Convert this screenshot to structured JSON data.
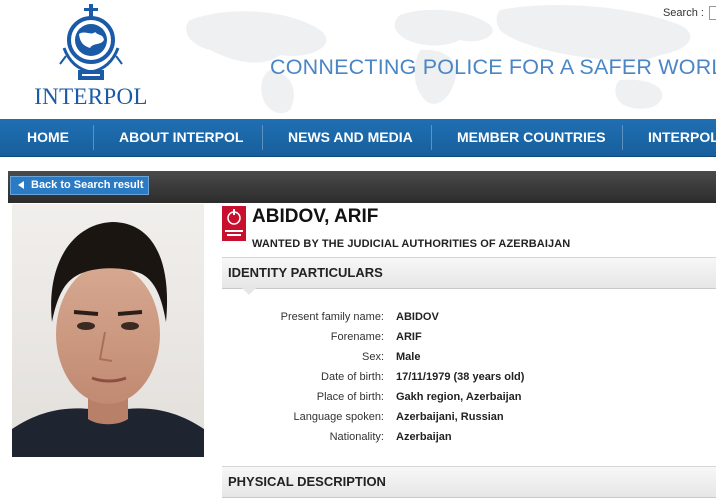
{
  "header": {
    "logo_text": "INTERPOL",
    "search_label": "Search :",
    "tagline": "CONNECTING POLICE FOR A SAFER WORLD"
  },
  "nav": {
    "items": [
      {
        "label": "HOME"
      },
      {
        "label": "ABOUT INTERPOL"
      },
      {
        "label": "NEWS AND MEDIA"
      },
      {
        "label": "MEMBER COUNTRIES"
      },
      {
        "label": "INTERPOL"
      }
    ]
  },
  "back_button": {
    "label": "Back to Search result"
  },
  "notice": {
    "name": "ABIDOV, ARIF",
    "wanted_by": "WANTED BY THE JUDICIAL AUTHORITIES OF AZERBAIJAN",
    "icon": "red-notice-icon"
  },
  "sections": {
    "identity_title": "IDENTITY PARTICULARS",
    "physical_title": "PHYSICAL DESCRIPTION"
  },
  "identity": [
    {
      "label": "Present family name:",
      "value": "ABIDOV"
    },
    {
      "label": "Forename:",
      "value": "ARIF"
    },
    {
      "label": "Sex:",
      "value": "Male"
    },
    {
      "label": "Date of birth:",
      "value": "17/11/1979 (38 years old)"
    },
    {
      "label": "Place of birth:",
      "value": "Gakh region, Azerbaijan"
    },
    {
      "label": "Language spoken:",
      "value": "Azerbaijani, Russian"
    },
    {
      "label": "Nationality:",
      "value": "Azerbaijan"
    }
  ],
  "colors": {
    "nav_blue": "#1f6fb3",
    "logo_blue": "#1a5aa6",
    "tagline_blue": "#4a86c5",
    "notice_red": "#c8102e"
  }
}
